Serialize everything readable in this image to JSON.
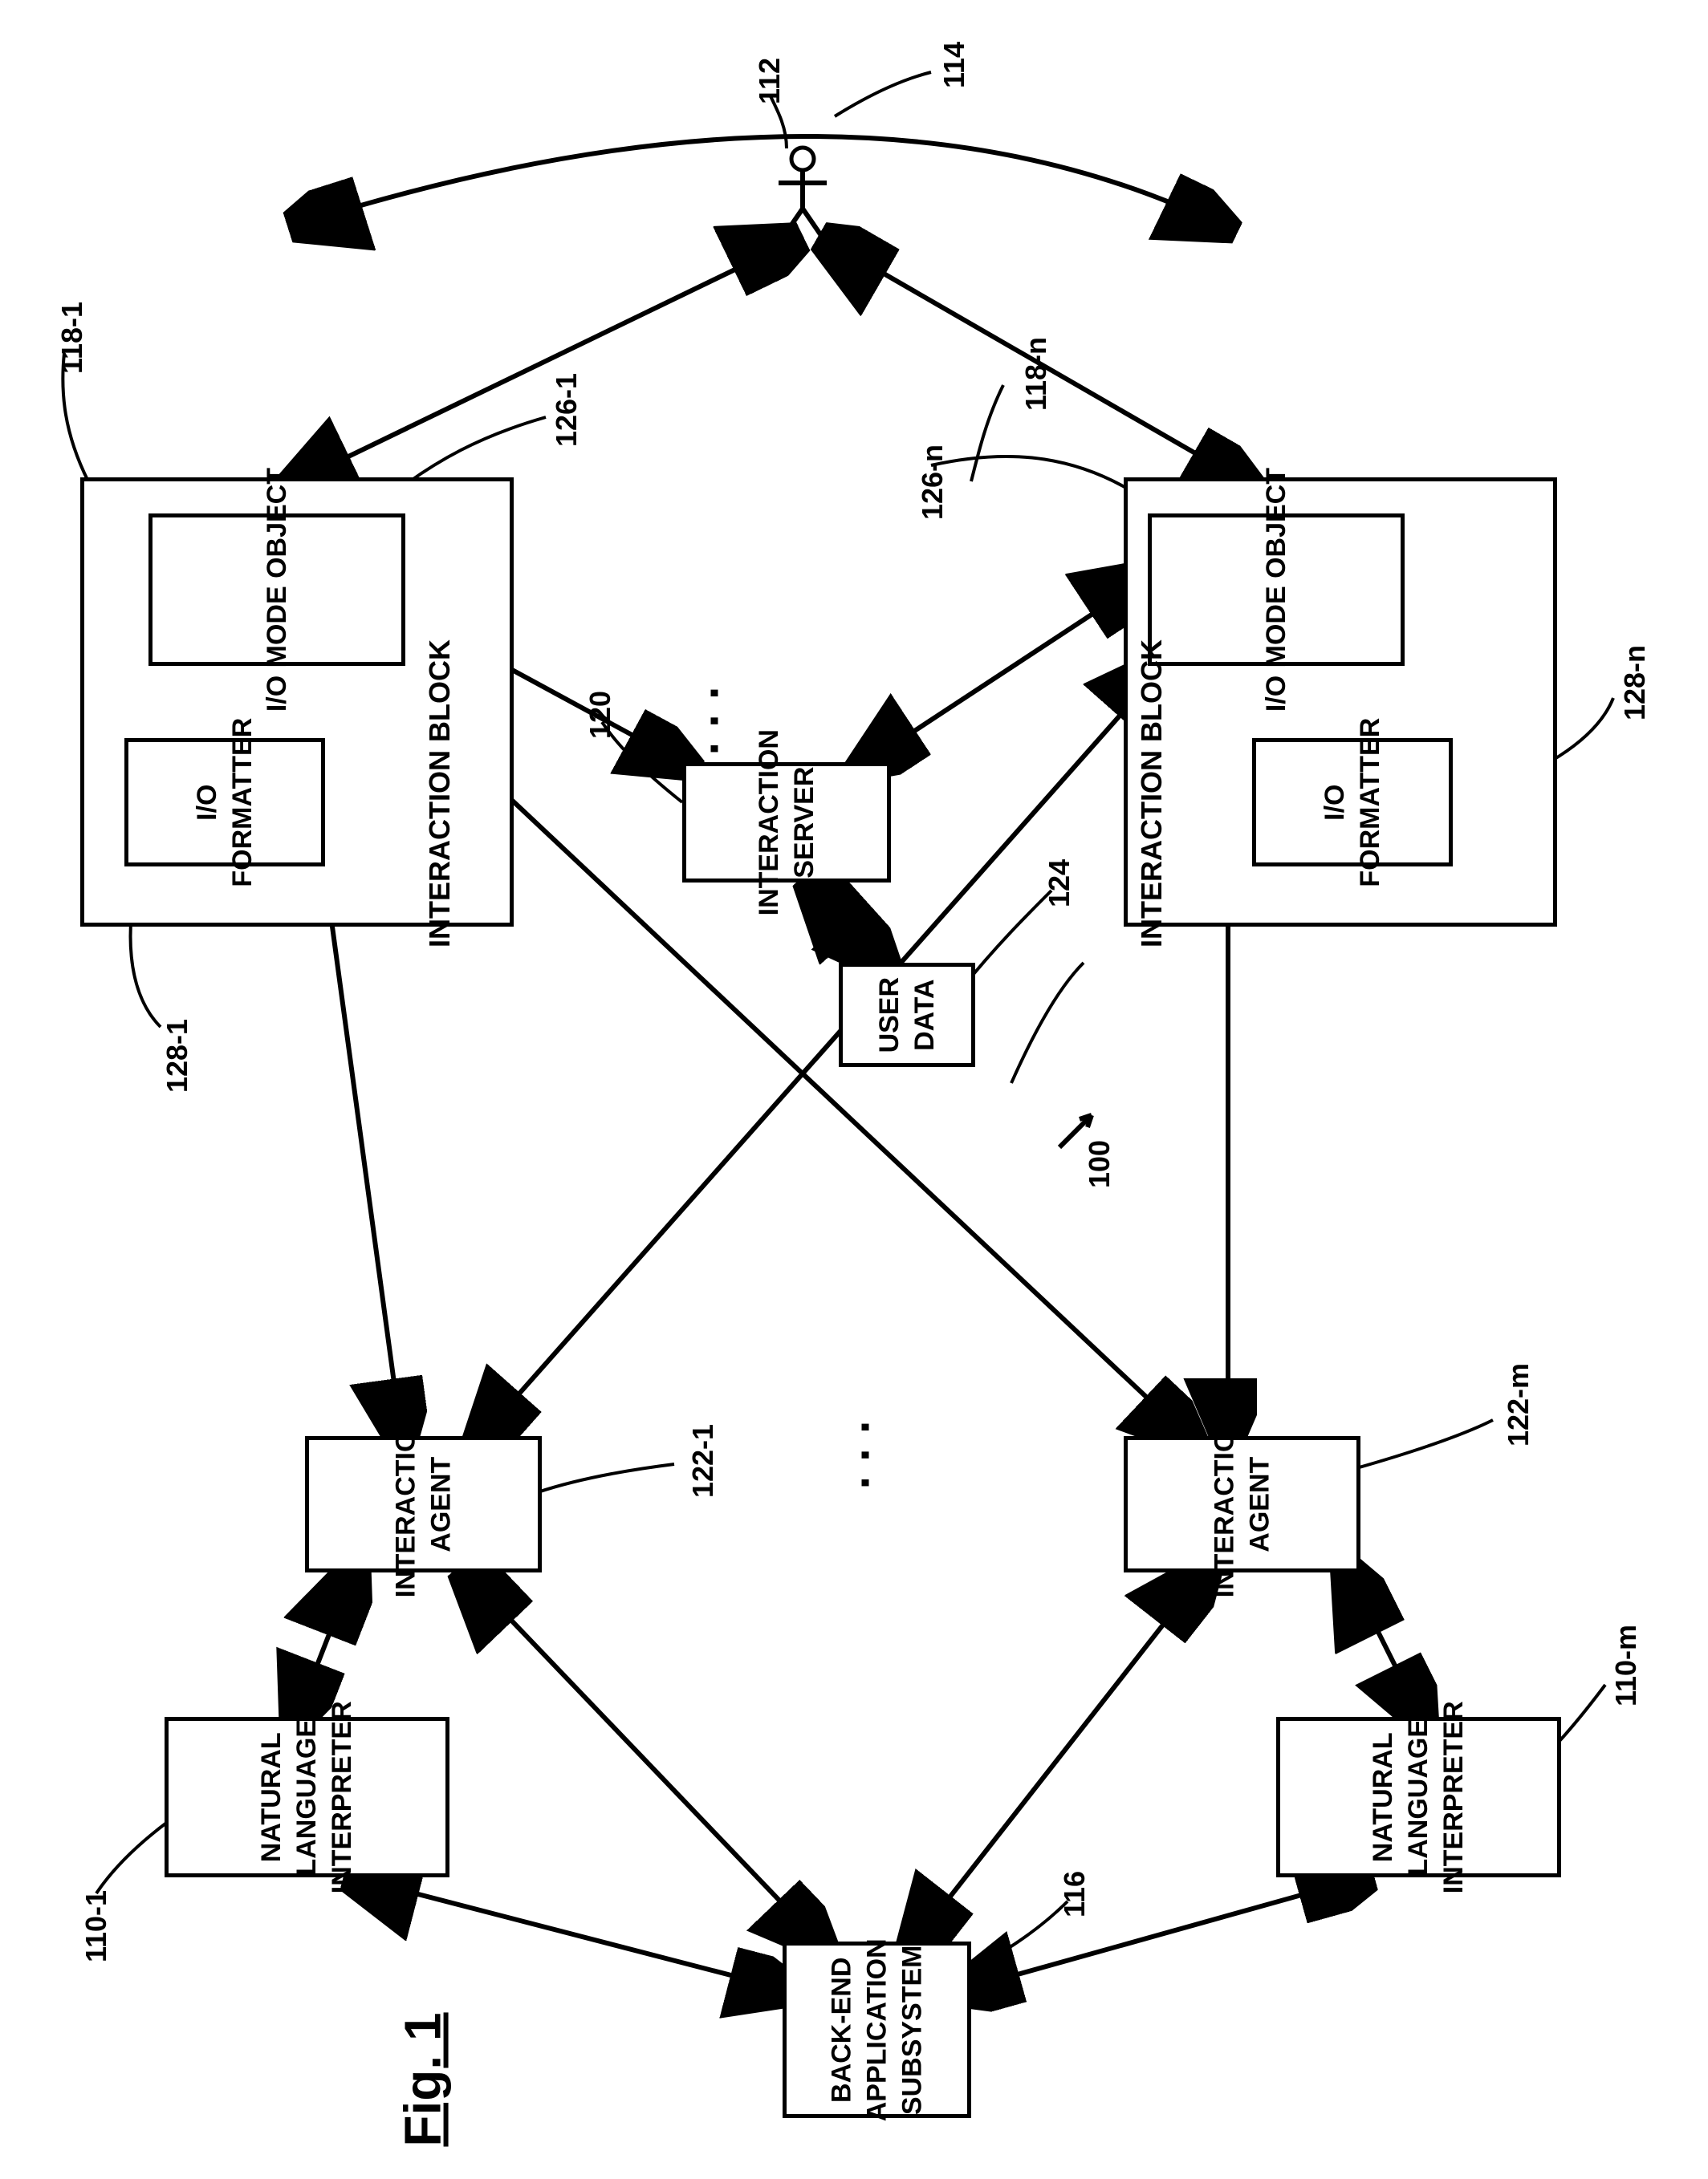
{
  "figure_label": "Fig. 1",
  "user_label": "112",
  "io_network_label": "114",
  "system_label": "100",
  "interaction_block_left": {
    "title": "INTERACTION BLOCK",
    "ref": "118-1",
    "io_mode": {
      "text": "I/O MODE OBJECT",
      "ref": "126-1"
    },
    "io_formatter": {
      "text": "I/O FORMATTER",
      "ref": "128-1"
    }
  },
  "interaction_block_right": {
    "title": "INTERACTION BLOCK",
    "ref": "118-n",
    "io_mode": {
      "text": "I/O MODE OBJECT",
      "ref": "126-n"
    },
    "io_formatter": {
      "text": "I/O FORMATTER",
      "ref": "128-n"
    }
  },
  "interaction_server": {
    "text": "INTERACTION SERVER",
    "ref": "120"
  },
  "user_data": {
    "text": "USER DATA",
    "ref": "124"
  },
  "interaction_agent_left": {
    "text": "INTERACTION AGENT",
    "ref": "122-1"
  },
  "interaction_agent_right": {
    "text": "INTERACTION AGENT",
    "ref": "122-m"
  },
  "nli_left": {
    "text": "NATURAL LANGUAGE INTERPRETER",
    "ref": "110-1"
  },
  "nli_right": {
    "text": "NATURAL LANGUAGE INTERPRETER",
    "ref": "110-m"
  },
  "backend": {
    "text": "BACK-END APPLICATION SUBSYSTEM",
    "ref": "116"
  }
}
